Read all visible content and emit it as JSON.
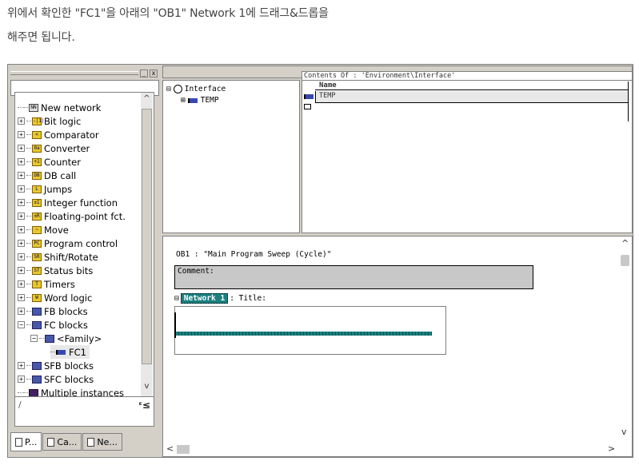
{
  "caption": {
    "line1": "위에서 확인한 \"FC1\"을 아래의 \"OB1\" Network 1에 드래그&드롭을",
    "line2": "해주면 됩니다."
  },
  "palette": {
    "close_glyph": "x",
    "restore_glyph": "_",
    "items": [
      {
        "label": "New network",
        "icon": "new-network-icon",
        "icon_text": "NN"
      },
      {
        "label": "Bit logic",
        "icon": "bit-logic-icon",
        "icon_text": "-|1|"
      },
      {
        "label": "Comparator",
        "icon": "comparator-icon",
        "icon_text": "<"
      },
      {
        "label": "Converter",
        "icon": "converter-icon",
        "icon_text": "0a"
      },
      {
        "label": "Counter",
        "icon": "counter-icon",
        "icon_text": "+1"
      },
      {
        "label": "DB call",
        "icon": "db-call-icon",
        "icon_text": "DB"
      },
      {
        "label": "Jumps",
        "icon": "jumps-icon",
        "icon_text": "L"
      },
      {
        "label": "Integer function",
        "icon": "integer-function-icon",
        "icon_text": "±I"
      },
      {
        "label": "Floating-point fct.",
        "icon": "floating-point-icon",
        "icon_text": "±R"
      },
      {
        "label": "Move",
        "icon": "move-icon",
        "icon_text": "~"
      },
      {
        "label": "Program control",
        "icon": "program-control-icon",
        "icon_text": "PC"
      },
      {
        "label": "Shift/Rotate",
        "icon": "shift-rotate-icon",
        "icon_text": "SR"
      },
      {
        "label": "Status bits",
        "icon": "status-bits-icon",
        "icon_text": "ST"
      },
      {
        "label": "Timers",
        "icon": "timers-icon",
        "icon_text": "T"
      },
      {
        "label": "Word logic",
        "icon": "word-logic-icon",
        "icon_text": "W"
      },
      {
        "label": "FB blocks",
        "icon": "fb-blocks-icon",
        "icon_text": ""
      },
      {
        "label": "FC blocks",
        "icon": "fc-blocks-icon",
        "icon_text": ""
      },
      {
        "label": "<Family>",
        "icon": "family-icon",
        "icon_text": ""
      },
      {
        "label": "FC1",
        "icon": "fc1-icon",
        "icon_text": ""
      },
      {
        "label": "SFB blocks",
        "icon": "sfb-blocks-icon",
        "icon_text": ""
      },
      {
        "label": "SFC blocks",
        "icon": "sfc-blocks-icon",
        "icon_text": ""
      },
      {
        "label": "Multiple instances",
        "icon": "multiple-instances-icon",
        "icon_text": ""
      }
    ],
    "bottom_slash": "/",
    "bottom_mark": "ᵋ≤",
    "tabs": [
      {
        "label": "P...",
        "icon": "program-elements-icon"
      },
      {
        "label": "Ca...",
        "icon": "call-structure-icon"
      },
      {
        "label": "Ne...",
        "icon": "network-icon"
      }
    ]
  },
  "interface": {
    "root_label": "Interface",
    "child_label": "TEMP",
    "expand_glyph": "⊟",
    "collapse_glyph": "⊞"
  },
  "contents": {
    "header": "Contents Of : 'Environment\\Interface'",
    "column_name": "Name",
    "rows": [
      "TEMP"
    ]
  },
  "editor": {
    "block_title": "OB1 :   \"Main Program Sweep (Cycle)\"",
    "comment_label": "Comment:",
    "network_toggle": "⊟",
    "network_label": "Network 1",
    "network_title": ": Title:"
  }
}
